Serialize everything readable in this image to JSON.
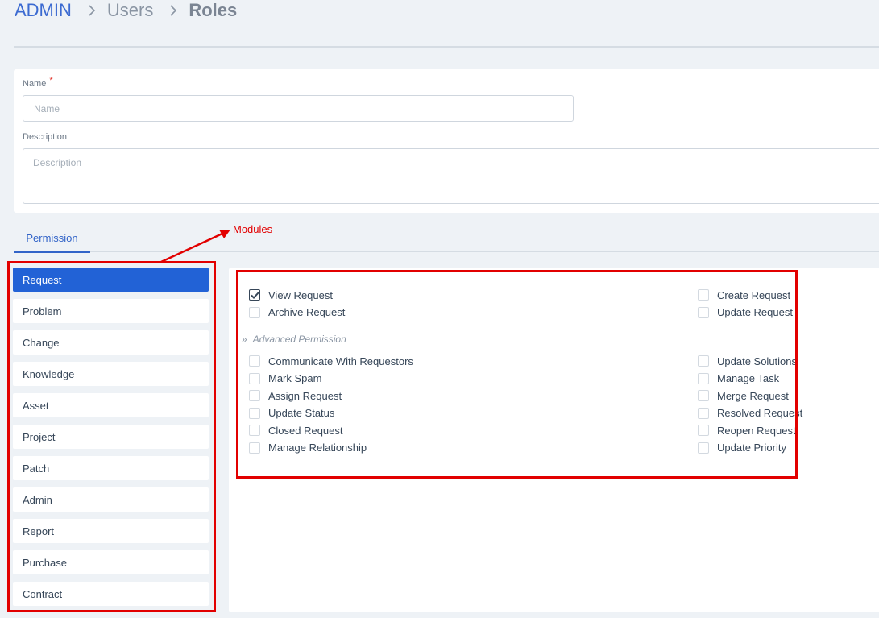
{
  "breadcrumb": {
    "admin": "ADMIN",
    "users": "Users",
    "roles": "Roles"
  },
  "form": {
    "name_label": "Name",
    "required_mark": "*",
    "name_placeholder": "Name",
    "name_value": "",
    "description_label": "Description",
    "description_placeholder": "Description",
    "description_value": ""
  },
  "tabs": {
    "permission": "Permission"
  },
  "annotation": {
    "label": "Modules",
    "color": "#e20000"
  },
  "modules": [
    {
      "label": "Request",
      "active": true
    },
    {
      "label": "Problem",
      "active": false
    },
    {
      "label": "Change",
      "active": false
    },
    {
      "label": "Knowledge",
      "active": false
    },
    {
      "label": "Asset",
      "active": false
    },
    {
      "label": "Project",
      "active": false
    },
    {
      "label": "Patch",
      "active": false
    },
    {
      "label": "Admin",
      "active": false
    },
    {
      "label": "Report",
      "active": false
    },
    {
      "label": "Purchase",
      "active": false
    },
    {
      "label": "Contract",
      "active": false
    }
  ],
  "permissions": {
    "basic_left": [
      {
        "label": "View Request",
        "checked": true
      },
      {
        "label": "Archive Request",
        "checked": false
      }
    ],
    "basic_right": [
      {
        "label": "Create Request",
        "checked": false
      },
      {
        "label": "Update Request",
        "checked": false
      }
    ],
    "advanced_title": "Advanced Permission",
    "advanced_left": [
      {
        "label": "Communicate With Requestors",
        "checked": false
      },
      {
        "label": "Mark Spam",
        "checked": false
      },
      {
        "label": "Assign Request",
        "checked": false
      },
      {
        "label": "Update Status",
        "checked": false
      },
      {
        "label": "Closed Request",
        "checked": false
      },
      {
        "label": "Manage Relationship",
        "checked": false
      }
    ],
    "advanced_right": [
      {
        "label": "Update Solutions",
        "checked": false
      },
      {
        "label": "Manage Task",
        "checked": false
      },
      {
        "label": "Merge Request",
        "checked": false
      },
      {
        "label": "Resolved Request",
        "checked": false
      },
      {
        "label": "Reopen Request",
        "checked": false
      },
      {
        "label": "Update Priority",
        "checked": false
      }
    ]
  },
  "colors": {
    "accent": "#2262d6",
    "tab_accent": "#3264c8",
    "page_bg": "#eef2f6"
  },
  "icons": {
    "breadcrumb_separator": "chevron-right-icon",
    "advanced": "double-chevron-right-icon",
    "checkbox_checked": "check-icon"
  }
}
